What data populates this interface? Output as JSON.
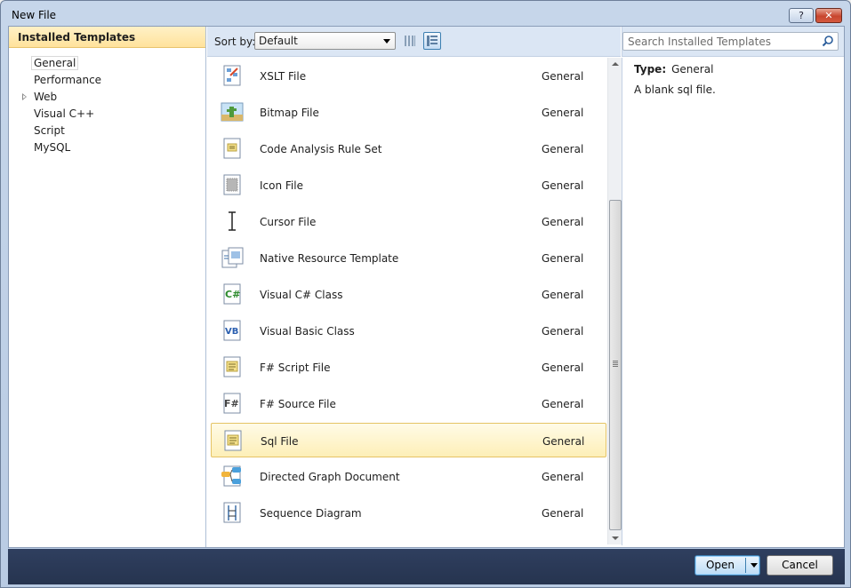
{
  "window": {
    "title": "New File",
    "help_label": "?",
    "close_label": "✕"
  },
  "left_pane": {
    "header": "Installed Templates",
    "categories": [
      {
        "label": "General",
        "selected": true,
        "expandable": false
      },
      {
        "label": "Performance",
        "selected": false,
        "expandable": false
      },
      {
        "label": "Web",
        "selected": false,
        "expandable": true
      },
      {
        "label": "Visual C++",
        "selected": false,
        "expandable": false
      },
      {
        "label": "Script",
        "selected": false,
        "expandable": false
      },
      {
        "label": "MySQL",
        "selected": false,
        "expandable": false
      }
    ]
  },
  "toolbar": {
    "sort_label": "Sort by:",
    "sort_value": "Default"
  },
  "search": {
    "placeholder": "Search Installed Templates"
  },
  "templates": [
    {
      "name": "XSLT File",
      "type": "General",
      "icon": "xslt-file-icon"
    },
    {
      "name": "Bitmap File",
      "type": "General",
      "icon": "bitmap-file-icon"
    },
    {
      "name": "Code Analysis Rule Set",
      "type": "General",
      "icon": "rule-set-icon"
    },
    {
      "name": "Icon File",
      "type": "General",
      "icon": "icon-file-icon"
    },
    {
      "name": "Cursor File",
      "type": "General",
      "icon": "cursor-file-icon"
    },
    {
      "name": "Native Resource Template",
      "type": "General",
      "icon": "native-resource-icon"
    },
    {
      "name": "Visual C# Class",
      "type": "General",
      "icon": "csharp-class-icon"
    },
    {
      "name": "Visual Basic Class",
      "type": "General",
      "icon": "vb-class-icon"
    },
    {
      "name": "F# Script File",
      "type": "General",
      "icon": "fsharp-script-icon"
    },
    {
      "name": "F# Source File",
      "type": "General",
      "icon": "fsharp-source-icon"
    },
    {
      "name": "Sql File",
      "type": "General",
      "icon": "sql-file-icon",
      "selected": true
    },
    {
      "name": "Directed Graph Document",
      "type": "General",
      "icon": "directed-graph-icon"
    },
    {
      "name": "Sequence Diagram",
      "type": "General",
      "icon": "sequence-diagram-icon"
    }
  ],
  "details": {
    "type_label": "Type:",
    "type_value": "General",
    "description": "A blank sql file."
  },
  "footer": {
    "open_label": "Open",
    "cancel_label": "Cancel"
  },
  "colors": {
    "selection_fill": "#fdefb7",
    "selection_border": "#e5c365",
    "header_gold": "#ffe29c",
    "footer_navy": "#2b3a58"
  }
}
